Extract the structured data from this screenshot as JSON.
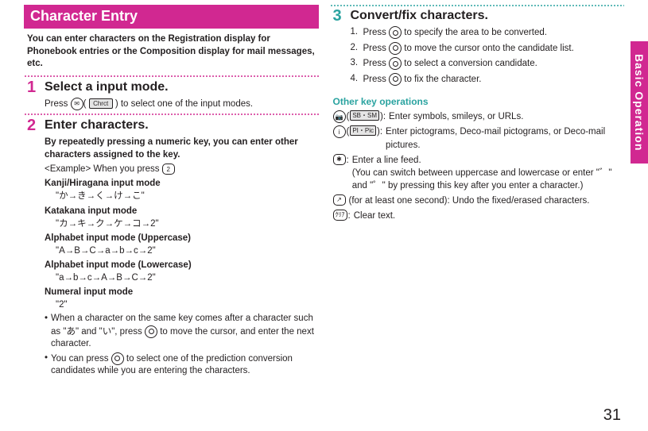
{
  "sideTab": "Basic Operation",
  "pageNum": "31",
  "left": {
    "header": "Character Entry",
    "lead": "You can enter characters on the Registration display for Phonebook entries or the Composition display for mail messages, etc.",
    "step1": {
      "num": "1",
      "title": "Select a input mode.",
      "press_a": "Press ",
      "chrct": "Chrct",
      "press_b": ") to select one of the input modes."
    },
    "step2": {
      "num": "2",
      "title": "Enter characters.",
      "bold1": "By repeatedly pressing a numeric key, you can enter other characters assigned to the key.",
      "example_a": "<Example> When you press ",
      "key2": "2",
      "mode1_t": "Kanji/Hiragana input mode",
      "mode1_v": "\"か→き→く→け→こ\"",
      "mode2_t": "Katakana input mode",
      "mode2_v": "\"カ→キ→ク→ケ→コ→2\"",
      "mode3_t": "Alphabet input mode (Uppercase)",
      "mode3_v": "\"A→B→C→a→b→c→2\"",
      "mode4_t": "Alphabet input mode (Lowercase)",
      "mode4_v": "\"a→b→c→A→B→C→2\"",
      "mode5_t": "Numeral input mode",
      "mode5_v": "\"2\"",
      "b1_a": "When a character on the same key comes after a character such as \"あ\" and \"い\", press ",
      "b1_b": " to move the cursor, and enter the next character.",
      "b2_a": "You can press ",
      "b2_b": " to select one of the prediction conversion candidates while you are entering the characters."
    }
  },
  "right": {
    "step3": {
      "num": "3",
      "title": "Convert/fix characters.",
      "l1a": "Press ",
      "l1b": " to specify the area to be converted.",
      "l2a": "Press ",
      "l2b": " to move the cursor onto the candidate list.",
      "l3a": "Press ",
      "l3b": " to select a conversion candidate.",
      "l4a": "Press ",
      "l4b": " to fix the character."
    },
    "otherHead": "Other key operations",
    "op1": {
      "pill": "SB・SM",
      "txt": "Enter symbols, smileys, or URLs."
    },
    "op2": {
      "pill": "PI・Pic",
      "txt": "Enter pictograms, Deco-mail pictograms, or Deco-mail pictures."
    },
    "op3a": "Enter a line feed.",
    "op3b": "(You can switch between uppercase and lowercase or enter \"゛\" and \"゜\" by pressing this key after you enter a character.)",
    "op4": " (for at least one second): Undo the fixed/erased characters.",
    "op5key": "ｸﾘｱ",
    "op5": "Clear text."
  }
}
